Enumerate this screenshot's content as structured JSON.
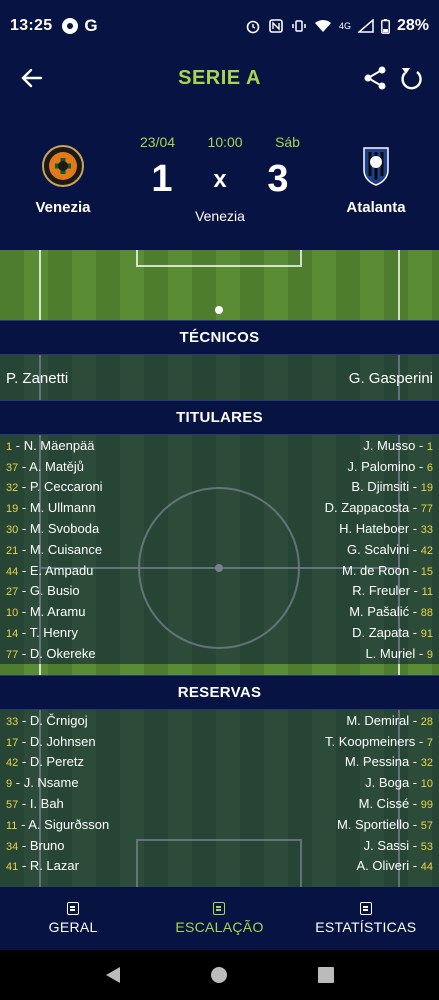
{
  "status": {
    "time": "13:25",
    "network": "4G",
    "battery": "28%"
  },
  "app": {
    "title": "SERIE A"
  },
  "match": {
    "date": "23/04",
    "time": "10:00",
    "day": "Sáb",
    "home": {
      "name": "Venezia",
      "goals": "1"
    },
    "away": {
      "name": "Atalanta",
      "goals": "3"
    },
    "separator": "x",
    "venue": "Venezia"
  },
  "sections": {
    "coaches": "TÉCNICOS",
    "starters": "TITULARES",
    "subs": "RESERVAS"
  },
  "coaches": {
    "home": "P. Zanetti",
    "away": "G. Gasperini"
  },
  "starters": [
    {
      "home_num": "1",
      "home_name": "N. Mäenpää",
      "away_name": "J. Musso",
      "away_num": "1"
    },
    {
      "home_num": "37",
      "home_name": "A. Matějů",
      "away_name": "J. Palomino",
      "away_num": "6"
    },
    {
      "home_num": "32",
      "home_name": "P. Ceccaroni",
      "away_name": "B. Djimsiti",
      "away_num": "19"
    },
    {
      "home_num": "19",
      "home_name": "M. Ullmann",
      "away_name": "D. Zappacosta",
      "away_num": "77"
    },
    {
      "home_num": "30",
      "home_name": "M. Svoboda",
      "away_name": "H. Hateboer",
      "away_num": "33"
    },
    {
      "home_num": "21",
      "home_name": "M. Cuisance",
      "away_name": "G. Scalvini",
      "away_num": "42"
    },
    {
      "home_num": "44",
      "home_name": "E. Ampadu",
      "away_name": "M. de Roon",
      "away_num": "15"
    },
    {
      "home_num": "27",
      "home_name": "G. Busio",
      "away_name": "R. Freuler",
      "away_num": "11"
    },
    {
      "home_num": "10",
      "home_name": "M. Aramu",
      "away_name": "M. Pašalić",
      "away_num": "88"
    },
    {
      "home_num": "14",
      "home_name": "T. Henry",
      "away_name": "D. Zapata",
      "away_num": "91"
    },
    {
      "home_num": "77",
      "home_name": "D. Okereke",
      "away_name": "L. Muriel",
      "away_num": "9"
    }
  ],
  "subs": [
    {
      "home_num": "33",
      "home_name": "D. Črnigoj",
      "away_name": "M. Demiral",
      "away_num": "28"
    },
    {
      "home_num": "17",
      "home_name": "D. Johnsen",
      "away_name": "T. Koopmeiners",
      "away_num": "7"
    },
    {
      "home_num": "42",
      "home_name": "D. Peretz",
      "away_name": "M. Pessina",
      "away_num": "32"
    },
    {
      "home_num": "9",
      "home_name": "J. Nsame",
      "away_name": "J. Boga",
      "away_num": "10"
    },
    {
      "home_num": "57",
      "home_name": "I. Bah",
      "away_name": "M. Cissé",
      "away_num": "99"
    },
    {
      "home_num": "11",
      "home_name": "A. Sigurðsson",
      "away_name": "M. Sportiello",
      "away_num": "57"
    },
    {
      "home_num": "34",
      "home_name": "Bruno",
      "away_name": "J. Sassi",
      "away_num": "53"
    },
    {
      "home_num": "41",
      "home_name": "R. Lazar",
      "away_name": "A. Oliveri",
      "away_num": "44"
    }
  ],
  "nav": {
    "tab1": "GERAL",
    "tab2": "ESCALAÇÃO",
    "tab3": "ESTATÍSTICAS"
  },
  "colors": {
    "header_bg": "#071343",
    "accent": "#a6d64b",
    "jersey_number": "#e7d54b"
  }
}
